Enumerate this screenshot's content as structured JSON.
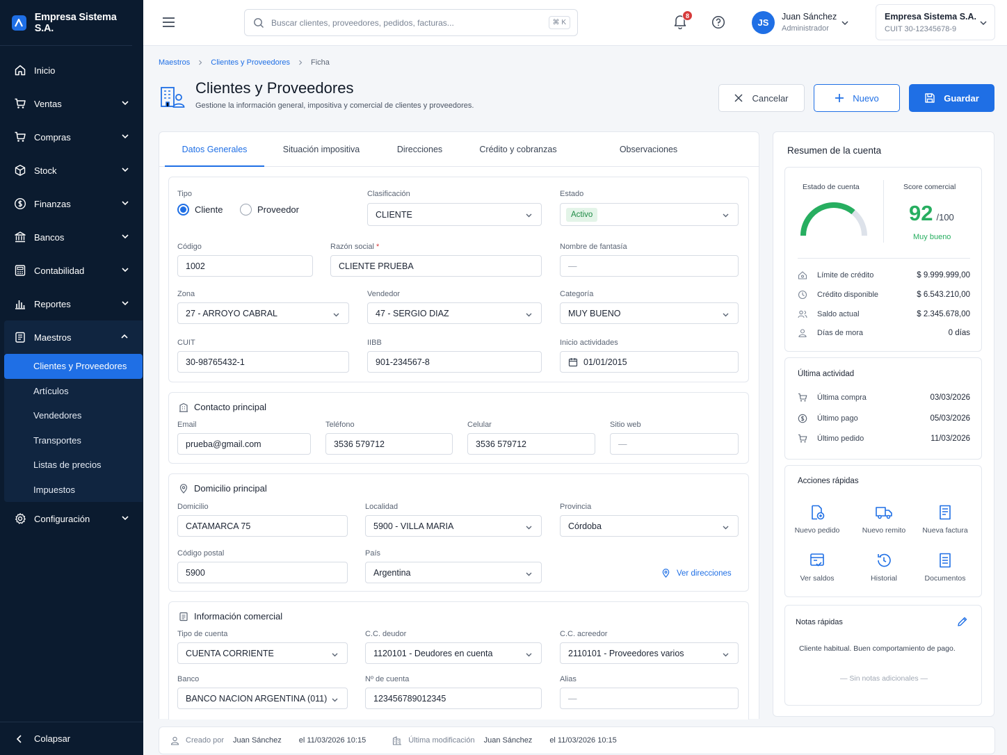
{
  "brand": {
    "name": "Empresa Sistema S.A."
  },
  "nav": {
    "items": [
      {
        "label": "Inicio",
        "icon": "home-icon"
      },
      {
        "label": "Ventas",
        "icon": "cart-icon"
      },
      {
        "label": "Compras",
        "icon": "cart-icon"
      },
      {
        "label": "Stock",
        "icon": "box-icon"
      },
      {
        "label": "Finanzas",
        "icon": "dollar-icon"
      },
      {
        "label": "Bancos",
        "icon": "bank-icon"
      },
      {
        "label": "Contabilidad",
        "icon": "calculator-icon"
      },
      {
        "label": "Reportes",
        "icon": "bar-chart-icon"
      },
      {
        "label": "Maestros",
        "icon": "clipboard-icon"
      }
    ],
    "sub": [
      "Clientes y Proveedores",
      "Artículos",
      "Vendedores",
      "Transportes",
      "Listas de precios",
      "Impuestos"
    ],
    "config": "Configuración",
    "collapse": "Colapsar"
  },
  "topbar": {
    "search_placeholder": "Buscar clientes, proveedores, pedidos, facturas...",
    "search_kbd": "⌘ K",
    "notif_count": "8",
    "user_initials": "JS",
    "user_name": "Juan Sánchez",
    "user_role": "Administrador",
    "company_name": "Empresa Sistema S.A.",
    "company_cuit": "CUIT 30-12345678-9"
  },
  "breadcrumb": [
    "Maestros",
    "Clientes y Proveedores",
    "Ficha"
  ],
  "page": {
    "title": "Clientes y Proveedores",
    "subtitle": "Gestione la información general, impositiva y comercial de clientes y proveedores.",
    "cancel": "Cancelar",
    "new": "Nuevo",
    "save": "Guardar"
  },
  "tabs": [
    "Datos Generales",
    "Situación impositiva",
    "Direcciones",
    "Crédito y cobranzas",
    "Observaciones"
  ],
  "general": {
    "tipo_label": "Tipo",
    "tipo_cliente": "Cliente",
    "tipo_proveedor": "Proveedor",
    "clasif_label": "Clasificación",
    "clasif": "CLIENTE",
    "estado_label": "Estado",
    "estado": "Activo",
    "codigo_label": "Código",
    "codigo": "1002",
    "razon_label": "Razón social",
    "razon_req": "*",
    "razon": "CLIENTE PRUEBA",
    "fantasia_label": "Nombre de fantasía",
    "fantasia": "—",
    "zona_label": "Zona",
    "zona": "27 - ARROYO CABRAL",
    "vendedor_label": "Vendedor",
    "vendedor": "47 - SERGIO DIAZ",
    "categoria_label": "Categoría",
    "categoria": "MUY BUENO",
    "cuit_label": "CUIT",
    "cuit": "30-98765432-1",
    "iibb_label": "IIBB",
    "iibb": "901-234567-8",
    "inicio_label": "Inicio actividades",
    "inicio": "01/01/2015"
  },
  "contacto": {
    "title": "Contacto principal",
    "email_label": "Email",
    "email": "prueba@gmail.com",
    "tel_label": "Teléfono",
    "tel": "3536 579712",
    "cel_label": "Celular",
    "cel": "3536 579712",
    "web_label": "Sitio web",
    "web": "—"
  },
  "domicilio": {
    "title": "Domicilio principal",
    "dom_label": "Domicilio",
    "dom": "CATAMARCA 75",
    "loc_label": "Localidad",
    "loc": "5900 - VILLA MARIA",
    "prov_label": "Provincia",
    "prov": "Córdoba",
    "cp_label": "Código postal",
    "cp": "5900",
    "pais_label": "País",
    "pais": "Argentina",
    "ver": "Ver direcciones"
  },
  "comercial": {
    "title": "Información comercial",
    "tipo_label": "Tipo de cuenta",
    "tipo": "CUENTA CORRIENTE",
    "deudor_label": "C.C. deudor",
    "deudor": "1120101 - Deudores en cuenta",
    "acreedor_label": "C.C. acreedor",
    "acreedor": "2110101 - Proveedores varios",
    "banco_label": "Banco",
    "banco": "BANCO NACION ARGENTINA (011)",
    "nro_label": "Nº de cuenta",
    "nro": "123456789012345",
    "alias_label": "Alias",
    "alias": "—"
  },
  "footer": {
    "created_label": "Creado por",
    "created_by": "Juan Sánchez",
    "created_at": "el 11/03/2026 10:15",
    "mod_label": "Última modificación",
    "mod_by": "Juan Sánchez",
    "mod_at": "el 11/03/2026 10:15"
  },
  "resumen": {
    "title": "Resumen de la cuenta",
    "estado_label": "Estado de cuenta",
    "gauge_fraction": 0.72,
    "score_label": "Score comercial",
    "score": "92",
    "score_max": "/100",
    "score_text": "Muy bueno",
    "rows": [
      {
        "label": "Límite de crédito",
        "value": "$ 9.999.999,00"
      },
      {
        "label": "Crédito disponible",
        "value": "$ 6.543.210,00"
      },
      {
        "label": "Saldo actual",
        "value": "$ 2.345.678,00"
      },
      {
        "label": "Días de mora",
        "value": "0 días"
      }
    ]
  },
  "actividad": {
    "title": "Última actividad",
    "rows": [
      {
        "label": "Última compra",
        "value": "03/03/2026"
      },
      {
        "label": "Último pago",
        "value": "05/03/2026"
      },
      {
        "label": "Último pedido",
        "value": "11/03/2026"
      }
    ]
  },
  "acciones": {
    "title": "Acciones rápidas",
    "items": [
      "Nuevo pedido",
      "Nuevo remito",
      "Nueva factura",
      "Ver saldos",
      "Historial",
      "Documentos"
    ]
  },
  "notas": {
    "title": "Notas rápidas",
    "text": "Cliente habitual. Buen comportamiento de pago.",
    "empty": "— Sin notas adicionales —"
  },
  "colors": {
    "accent": "#1f6fe5",
    "sidebar": "#0b1b2f",
    "success": "#27ae60"
  }
}
